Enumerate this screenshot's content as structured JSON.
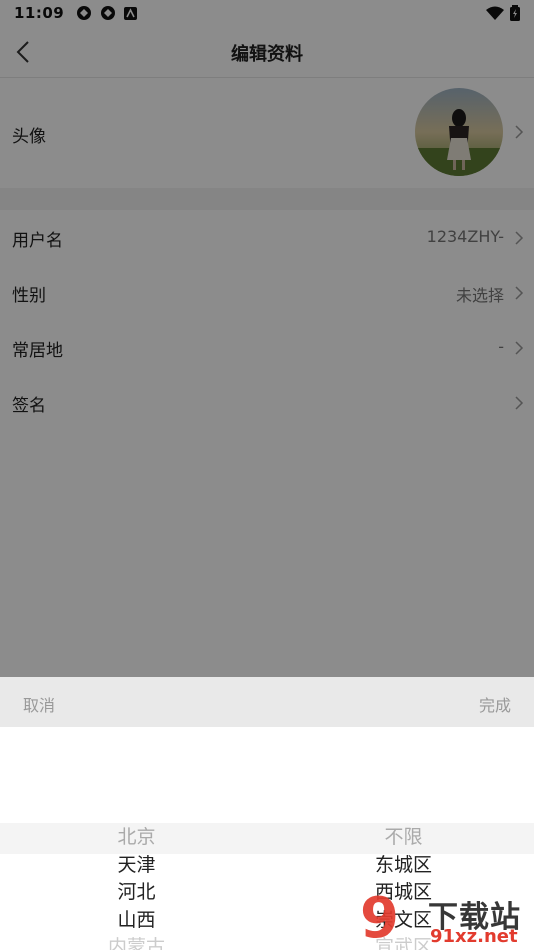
{
  "status_bar": {
    "time": "11:09"
  },
  "header": {
    "title": "编辑资料"
  },
  "avatar_row": {
    "label": "头像"
  },
  "rows": [
    {
      "label": "用户名",
      "value": "1234ZHY-"
    },
    {
      "label": "性别",
      "value": "未选择"
    },
    {
      "label": "常居地",
      "value": "-"
    },
    {
      "label": "签名",
      "value": ""
    }
  ],
  "picker": {
    "cancel_label": "取消",
    "done_label": "完成",
    "provinces": [
      "北京",
      "天津",
      "河北",
      "山西",
      "内蒙古"
    ],
    "districts": [
      "不限",
      "东城区",
      "西城区",
      "崇文区",
      "宣武区"
    ]
  },
  "watermark": {
    "brand": "下载站",
    "url": "91xz.net",
    "digits": "9"
  },
  "colors": {
    "dim_overlay": "#000000",
    "watermark_red": "#e23b2e"
  }
}
